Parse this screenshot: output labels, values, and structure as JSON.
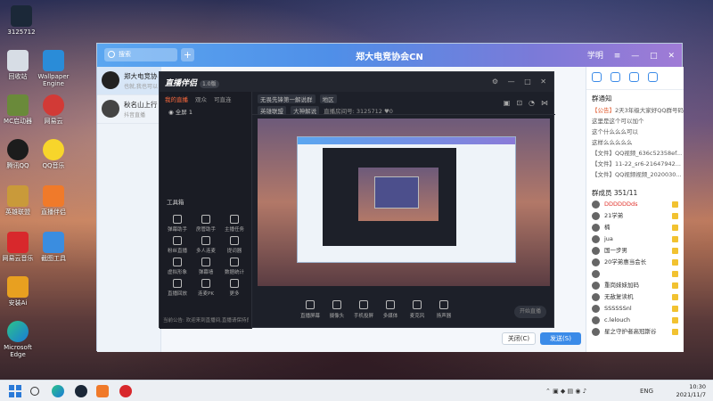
{
  "desktop": {
    "icons": [
      {
        "label": "3125712",
        "top_label": "Steam"
      },
      {
        "label": "回收站"
      },
      {
        "label": "Wallpaper Engine"
      },
      {
        "label": "MC启动器"
      },
      {
        "label": "网易云"
      },
      {
        "label": "腾讯QQ"
      },
      {
        "label": "QQ音乐"
      },
      {
        "label": "英雄联盟"
      },
      {
        "label": "直播伴侣"
      },
      {
        "label": "网易云音乐"
      },
      {
        "label": "截图工具"
      },
      {
        "label": "安装Ai"
      },
      {
        "label": "Microsoft Edge"
      }
    ]
  },
  "qq_window": {
    "title": "郑大电竞协会CN",
    "search_placeholder": "搜索",
    "user": "学明",
    "conversations": [
      {
        "name": "郑大电竞协",
        "sub": "也就,我也可以"
      },
      {
        "name": "秋名山上行",
        "sub": "抖音直播"
      }
    ],
    "group_notice_title": "群通知",
    "notices": [
      {
        "prefix": "【公告】",
        "text": "2天3年级大家好QQ群号码的"
      },
      {
        "prefix": "",
        "text": "这里是这个可以加个"
      },
      {
        "prefix": "",
        "text": "这个什么么么可以"
      },
      {
        "prefix": "",
        "text": "这样么么么么么"
      }
    ],
    "files": [
      {
        "prefix": "【文件】",
        "text": "QQ视频_636c52358ef..."
      },
      {
        "prefix": "【文件】",
        "text": "11-22_sr6-21647942..."
      },
      {
        "prefix": "【文件】",
        "text": "QQ视频视频_2020030..."
      }
    ],
    "members_label": "群成员 351/11",
    "members": [
      {
        "name": "DDDDDDds",
        "red": true
      },
      {
        "name": "21学弟",
        "red": false
      },
      {
        "name": "楠",
        "red": false
      },
      {
        "name": "jua",
        "red": false
      },
      {
        "name": "国一步男",
        "red": false
      },
      {
        "name": "20学弟惠当会长",
        "red": false
      },
      {
        "name": "",
        "red": false
      },
      {
        "name": "重岗妹妹加码",
        "red": false
      },
      {
        "name": "无敌复读机",
        "red": false
      },
      {
        "name": "SSSSSSnl",
        "red": false
      },
      {
        "name": "c.lelouch",
        "red": false
      },
      {
        "name": "星之守护者高冠斯谷",
        "red": false
      }
    ],
    "btn_close": "关闭(C)",
    "btn_send": "发送(S)"
  },
  "live_app": {
    "logo": "直播伴侣",
    "badge": "1.0版",
    "tabs": [
      "我的直播",
      "观众",
      "可直连"
    ],
    "scene": "全屏 1",
    "title_chip": "无畏先锋第一解说群",
    "status": "地区",
    "line2_chip1": "英雄联盟",
    "line2_chip2": "大神解说",
    "room_label": "直播房间号: 3125712",
    "fans": "0",
    "tools_title": "工具箱",
    "tools": [
      "弹幕助手",
      "房管助手",
      "主播任务",
      "粉丝直播",
      "多人连麦",
      "提词器",
      "虚拟形象",
      "弹幕墙",
      "数据统计",
      "直播回放",
      "连麦PK",
      "更多"
    ],
    "footer": "当前公告: 欢迎来到直播间,直播请保持良好...",
    "controls": [
      "直播屏幕",
      "摄像头",
      "手机投屏",
      "多媒体",
      "麦克风",
      "扬声器"
    ],
    "start_label": "开始直播"
  },
  "taskbar": {
    "lang": "ENG",
    "time": "10:30",
    "date": "2021/11/7"
  }
}
